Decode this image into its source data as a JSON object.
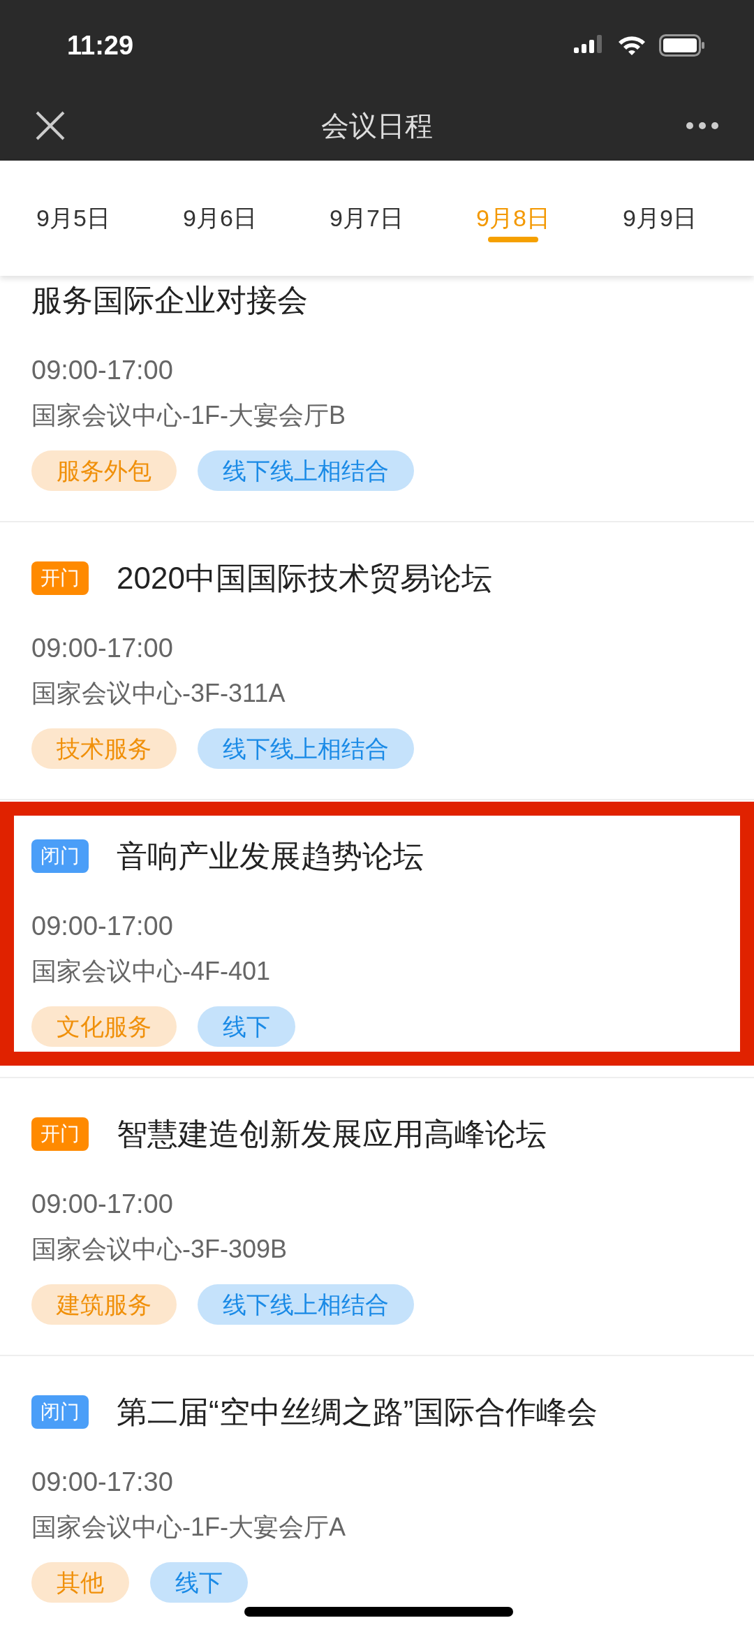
{
  "status_bar": {
    "time": "11:29"
  },
  "nav": {
    "title": "会议日程"
  },
  "tabs": [
    {
      "label": "9月5日",
      "selected": false
    },
    {
      "label": "9月6日",
      "selected": false
    },
    {
      "label": "9月7日",
      "selected": false
    },
    {
      "label": "9月8日",
      "selected": true
    },
    {
      "label": "9月9日",
      "selected": false
    }
  ],
  "sessions": [
    {
      "title": "服务国际企业对接会",
      "time": "09:00-17:00",
      "location": "国家会议中心-1F-大宴会厅B",
      "tags": [
        {
          "label": "服务外包",
          "kind": "category"
        },
        {
          "label": "线下线上相结合",
          "kind": "format"
        }
      ],
      "highlighted": false
    },
    {
      "badge": {
        "label": "开门",
        "kind": "open"
      },
      "title": "2020中国国际技术贸易论坛",
      "time": "09:00-17:00",
      "location": "国家会议中心-3F-311A",
      "tags": [
        {
          "label": "技术服务",
          "kind": "category"
        },
        {
          "label": "线下线上相结合",
          "kind": "format"
        }
      ],
      "highlighted": false
    },
    {
      "badge": {
        "label": "闭门",
        "kind": "closed"
      },
      "title": "音响产业发展趋势论坛",
      "time": "09:00-17:00",
      "location": "国家会议中心-4F-401",
      "tags": [
        {
          "label": "文化服务",
          "kind": "category"
        },
        {
          "label": "线下",
          "kind": "format"
        }
      ],
      "highlighted": true
    },
    {
      "badge": {
        "label": "开门",
        "kind": "open"
      },
      "title": "智慧建造创新发展应用高峰论坛",
      "time": "09:00-17:00",
      "location": "国家会议中心-3F-309B",
      "tags": [
        {
          "label": "建筑服务",
          "kind": "category"
        },
        {
          "label": "线下线上相结合",
          "kind": "format"
        }
      ],
      "highlighted": false
    },
    {
      "badge": {
        "label": "闭门",
        "kind": "closed"
      },
      "title": "第二届“空中丝绸之路”国际合作峰会",
      "time": "09:00-17:30",
      "location": "国家会议中心-1F-大宴会厅A",
      "tags": [
        {
          "label": "其他",
          "kind": "category"
        },
        {
          "label": "线下",
          "kind": "format"
        }
      ],
      "highlighted": false
    }
  ]
}
